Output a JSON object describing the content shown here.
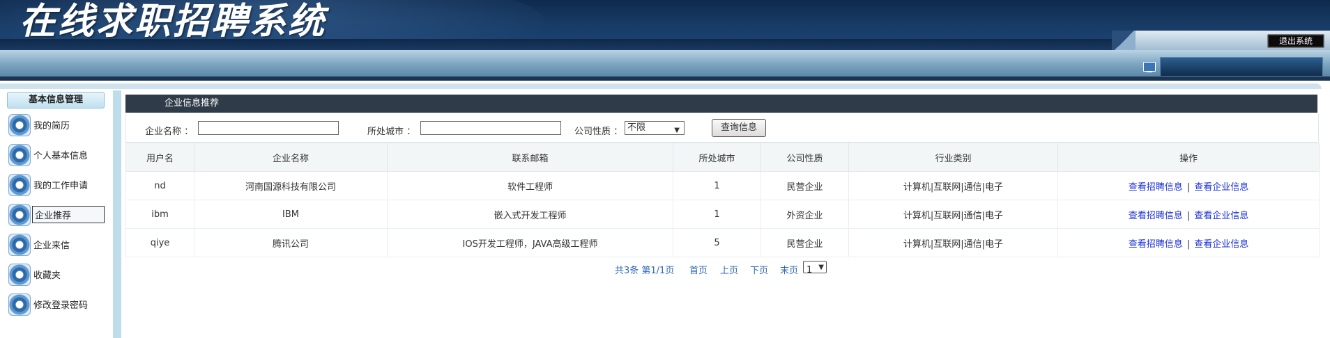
{
  "header": {
    "app_title": "在线求职招聘系统",
    "logout_label": "退出系统"
  },
  "sidebar": {
    "title": "基本信息管理",
    "items": [
      {
        "label": "我的简历",
        "icon": "gear-icon"
      },
      {
        "label": "个人基本信息",
        "icon": "gear-icon"
      },
      {
        "label": "我的工作申请",
        "icon": "gear-icon"
      },
      {
        "label": "企业推荐",
        "icon": "gear-icon",
        "active": true
      },
      {
        "label": "企业来信",
        "icon": "gear-icon"
      },
      {
        "label": "收藏夹",
        "icon": "gear-icon"
      },
      {
        "label": "修改登录密码",
        "icon": "gear-icon"
      }
    ]
  },
  "panel": {
    "title": "企业信息推荐"
  },
  "search": {
    "company_label": "企业名称 ：",
    "company_value": "",
    "city_label": "所处城市 ：",
    "city_value": "",
    "nature_label": "公司性质 ：",
    "nature_selected": "不限",
    "query_button": "查询信息"
  },
  "table": {
    "columns": [
      "用户名",
      "企业名称",
      "联系邮箱",
      "所处城市",
      "公司性质",
      "行业类别",
      "操作"
    ],
    "rows": [
      {
        "user": "nd",
        "company": "河南国源科技有限公司",
        "email": "软件工程师",
        "city": "1",
        "nature": "民营企业",
        "industry": "计算机|互联网|通信|电子"
      },
      {
        "user": "ibm",
        "company": "IBM",
        "email": "嵌入式开发工程师",
        "city": "1",
        "nature": "外资企业",
        "industry": "计算机|互联网|通信|电子"
      },
      {
        "user": "qiye",
        "company": "腾讯公司",
        "email": "IOS开发工程师，JAVA高级工程师",
        "city": "5",
        "nature": "民营企业",
        "industry": "计算机|互联网|通信|电子"
      }
    ],
    "action_view_jobs": "查看招聘信息",
    "action_separator": "|",
    "action_view_company": "查看企业信息"
  },
  "pager": {
    "summary": "共3条 第1/1页",
    "first": "首页",
    "prev": "上页",
    "next": "下页",
    "last": "末页",
    "page_selected": "1"
  },
  "colors": {
    "header_dark": "#173a63",
    "panel_head": "#2f3b48",
    "link_blue": "#1a2fd8",
    "pager_blue": "#2f68b3"
  }
}
